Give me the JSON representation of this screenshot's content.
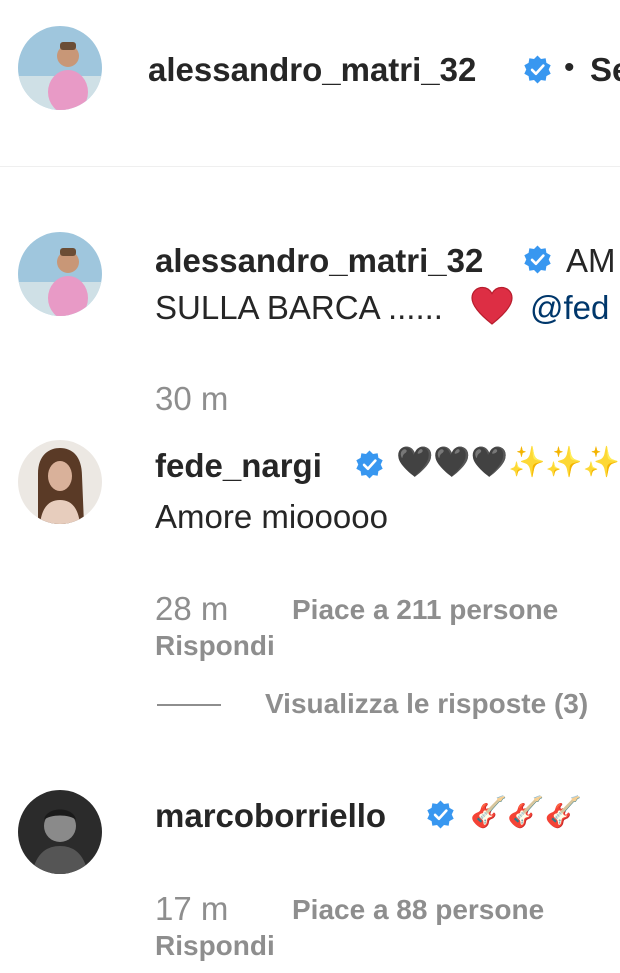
{
  "header": {
    "username": "alessandro_matri_32",
    "separator": "•",
    "follow_text": "Se"
  },
  "caption": {
    "username": "alessandro_matri_32",
    "text_start": "AM",
    "line2_text": "SULLA BARCA ......",
    "emoji": "❤️",
    "mention": "@fed",
    "time": "30 m"
  },
  "comments": [
    {
      "username": "fede_nargi",
      "emoji": "🖤🖤🖤✨✨✨",
      "text": "Amore miooooo",
      "time": "28 m",
      "likes": "Piace a 211 persone",
      "reply": "Rispondi",
      "view_replies": "Visualizza le risposte (3)"
    },
    {
      "username": "marcoborriello",
      "emoji": "🎸🎸🎸",
      "time": "17 m",
      "likes": "Piace a 88 persone",
      "reply": "Rispondi"
    }
  ],
  "colors": {
    "verified_blue": "#3897f0",
    "text_primary": "#262626",
    "text_secondary": "#8e8e8e",
    "mention": "#00376b",
    "heart_red": "#ed4956"
  }
}
